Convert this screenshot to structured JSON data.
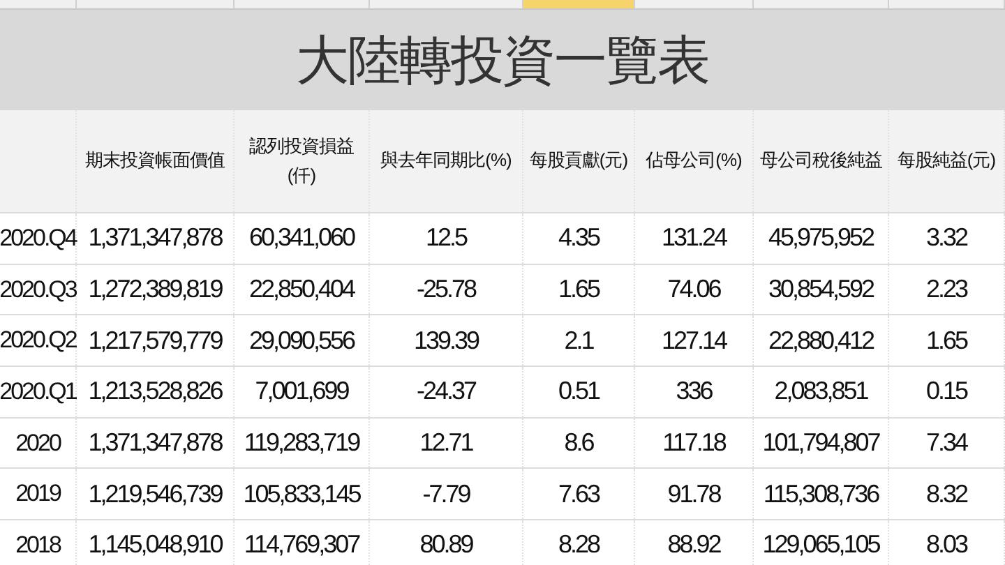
{
  "column_strip": [
    {
      "selected": false
    },
    {
      "selected": false
    },
    {
      "selected": false
    },
    {
      "selected": false
    },
    {
      "selected": true
    },
    {
      "selected": false
    },
    {
      "selected": false
    },
    {
      "selected": false
    }
  ],
  "title": "大陸轉投資一覽表",
  "table": {
    "columns": [
      "",
      "期末投資帳面價值",
      "認列投資損益(仟)",
      "與去年同期比(%)",
      "每股貢獻(元)",
      "佔母公司(%)",
      "母公司稅後純益",
      "每股純益(元)"
    ],
    "rows": [
      [
        "2020.Q4",
        "1,371,347,878",
        "60,341,060",
        "12.5",
        "4.35",
        "131.24",
        "45,975,952",
        "3.32"
      ],
      [
        "2020.Q3",
        "1,272,389,819",
        "22,850,404",
        "-25.78",
        "1.65",
        "74.06",
        "30,854,592",
        "2.23"
      ],
      [
        "2020.Q2",
        "1,217,579,779",
        "29,090,556",
        "139.39",
        "2.1",
        "127.14",
        "22,880,412",
        "1.65"
      ],
      [
        "2020.Q1",
        "1,213,528,826",
        "7,001,699",
        "-24.37",
        "0.51",
        "336",
        "2,083,851",
        "0.15"
      ],
      [
        "2020",
        "1,371,347,878",
        "119,283,719",
        "12.71",
        "8.6",
        "117.18",
        "101,794,807",
        "7.34"
      ],
      [
        "2019",
        "1,219,546,739",
        "105,833,145",
        "-7.79",
        "7.63",
        "91.78",
        "115,308,736",
        "8.32"
      ],
      [
        "2018",
        "1,145,048,910",
        "114,769,307",
        "80.89",
        "8.28",
        "88.92",
        "129,065,105",
        "8.03"
      ]
    ]
  }
}
